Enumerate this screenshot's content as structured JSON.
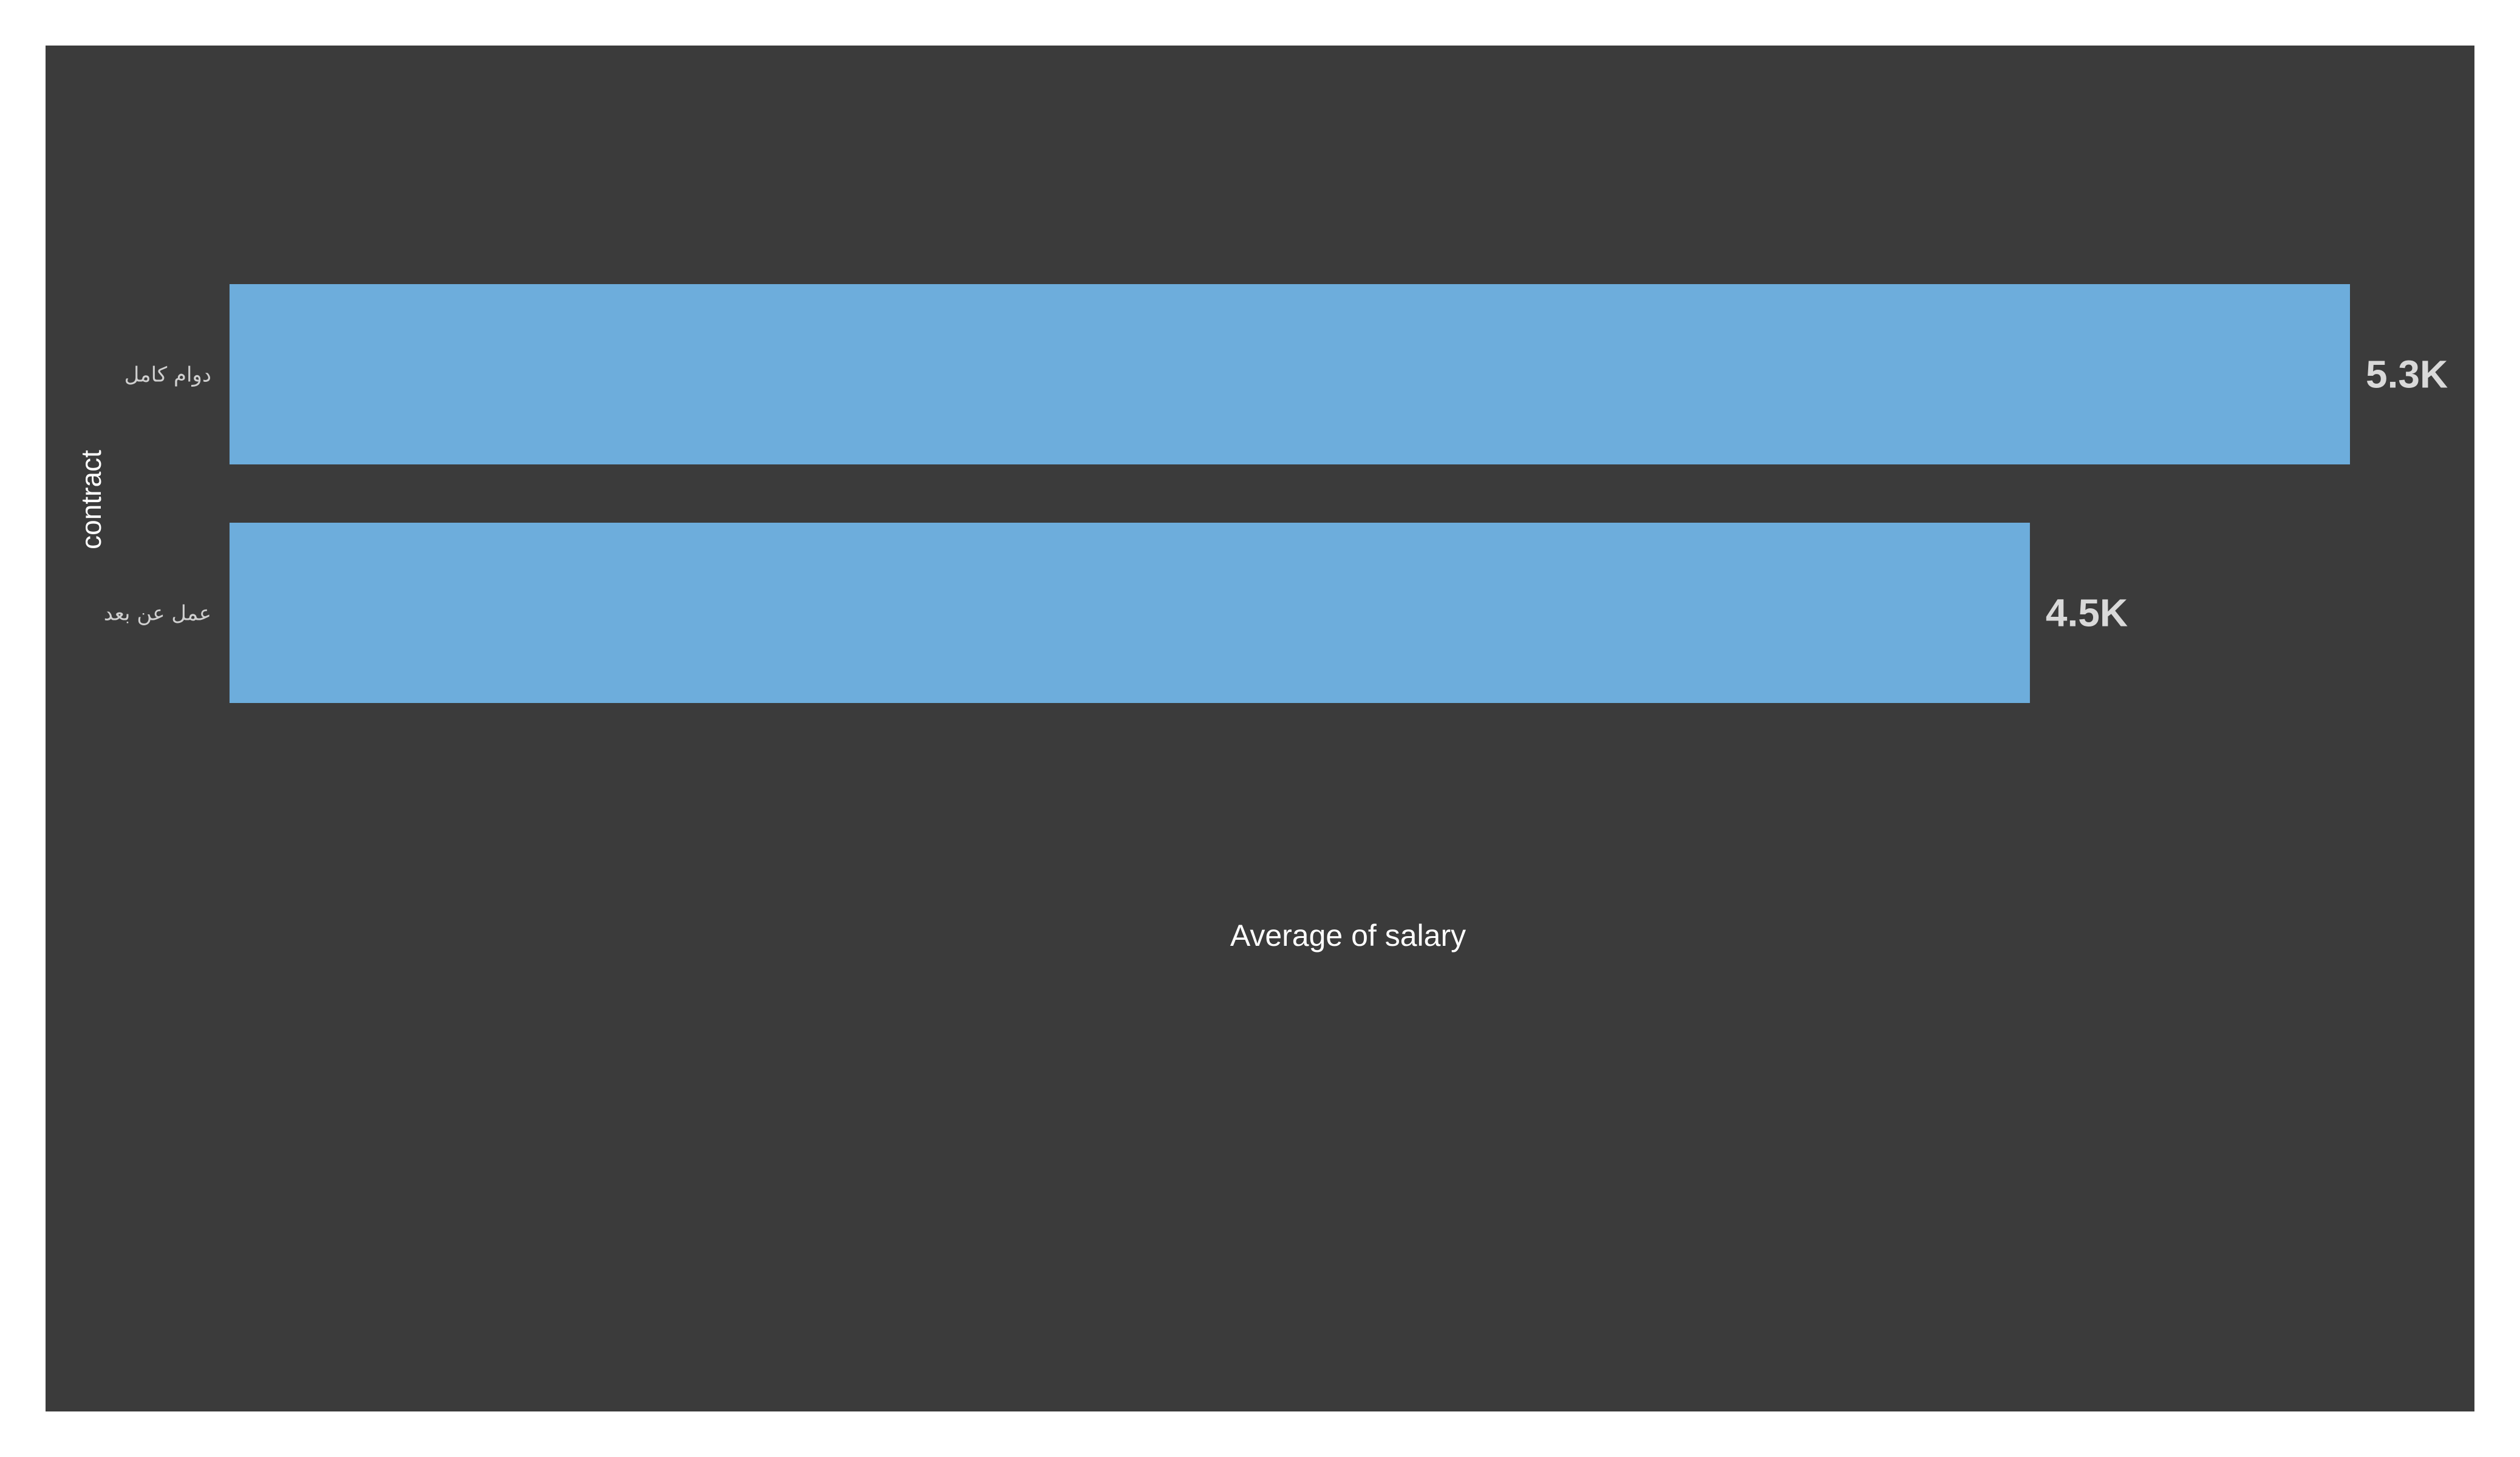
{
  "chart_data": {
    "type": "bar",
    "orientation": "horizontal",
    "categories": [
      "دوام كامل",
      "عمل عن بعد"
    ],
    "values": [
      5300,
      4500
    ],
    "data_labels": [
      "5.3K",
      "4.5K"
    ],
    "xlabel": "Average of salary",
    "ylabel": "contract",
    "grid": false,
    "legend": "none"
  },
  "colors": {
    "background": "#3b3b3b",
    "bar": "#6daddc",
    "axis_title": "#ffffff",
    "tick_label": "#cfcfcf",
    "data_label": "#d9d9d9"
  }
}
